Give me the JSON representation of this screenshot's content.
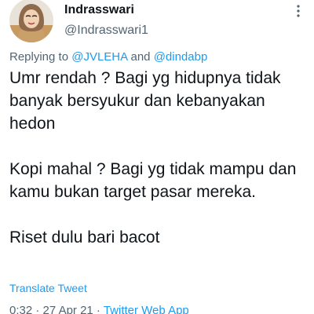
{
  "user": {
    "display_name": "Indrasswari",
    "username": "@Indrasswari1",
    "avatar_icon": "profile-photo-avatar"
  },
  "more_icon": "more-dots-icon",
  "reply_context": {
    "prefix": "Replying to ",
    "mention_1": "@JVLEHA",
    "conjunction": " and ",
    "mention_2": "@dindabp"
  },
  "tweet": {
    "paragraph_1": "Umr rendah ? Bagi yg hidupnya tidak banyak bersyukur dan kebanyakan hedon",
    "paragraph_2": "Kopi mahal ? Bagi yg tidak mampu dan kamu bukan target pasar mereka.",
    "paragraph_3": "Riset dulu bari bacot"
  },
  "translate_label": "Translate Tweet",
  "meta": {
    "time": "0:32",
    "separator_1": " · ",
    "date": "27 Apr 21",
    "separator_2": " · ",
    "source": "Twitter Web App"
  },
  "colors": {
    "link": "#1d9bf0",
    "secondary_text": "#536471",
    "primary_text": "#0f1419"
  }
}
